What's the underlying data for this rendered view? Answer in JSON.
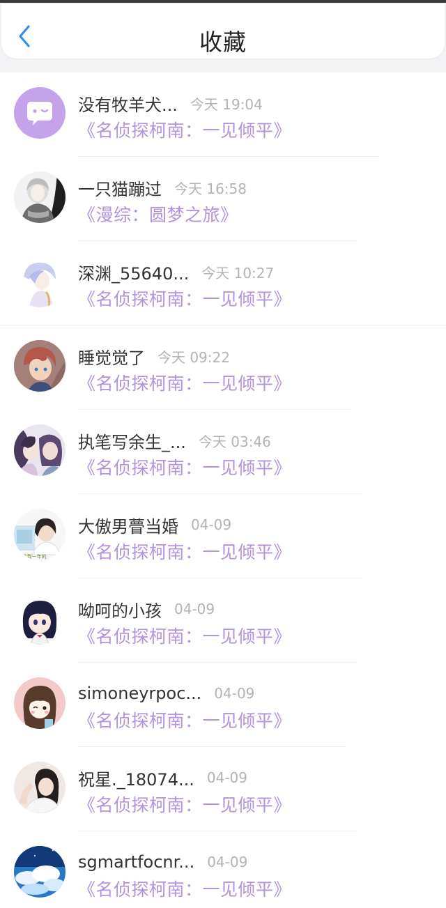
{
  "header": {
    "title": "收藏",
    "back_icon": "chevron-left-icon",
    "accent_color": "#2f8ff0"
  },
  "colors": {
    "book_title": "#b392de",
    "time": "#b3b3b3",
    "username": "#333333"
  },
  "items": [
    {
      "username": "没有牧羊犬...",
      "time": "今天 19:04",
      "book": "《名侦探柯南：一见倾平》",
      "avatar": "default-chat-avatar-icon"
    },
    {
      "username": "一只猫蹦过",
      "time": "今天 16:58",
      "book": "《漫综：圆梦之旅》",
      "avatar": "user-avatar"
    },
    {
      "username": "深渊_55640...",
      "time": "今天 10:27",
      "book": "《名侦探柯南：一见倾平》",
      "avatar": "user-avatar"
    },
    {
      "username": "睡觉觉了",
      "time": "今天 09:22",
      "book": "《名侦探柯南：一见倾平》",
      "avatar": "user-avatar"
    },
    {
      "username": "执笔写余生_...",
      "time": "今天 03:46",
      "book": "《名侦探柯南：一见倾平》",
      "avatar": "user-avatar"
    },
    {
      "username": "大傲男瞢当婚",
      "time": "04-09",
      "book": "《名侦探柯南：一见倾平》",
      "avatar": "user-avatar",
      "avatar_caption": "“是我一年的"
    },
    {
      "username": "呦呵的小孩",
      "time": "04-09",
      "book": "《名侦探柯南：一见倾平》",
      "avatar": "user-avatar"
    },
    {
      "username": "simoneyrpoc...",
      "time": "04-09",
      "book": "《名侦探柯南：一见倾平》",
      "avatar": "user-avatar"
    },
    {
      "username": "祝星._18074...",
      "time": "04-09",
      "book": "《名侦探柯南：一见倾平》",
      "avatar": "user-avatar"
    },
    {
      "username": "sgmartfocnr...",
      "time": "04-09",
      "book": "《名侦探柯南：一见倾平》",
      "avatar": "user-avatar"
    }
  ]
}
